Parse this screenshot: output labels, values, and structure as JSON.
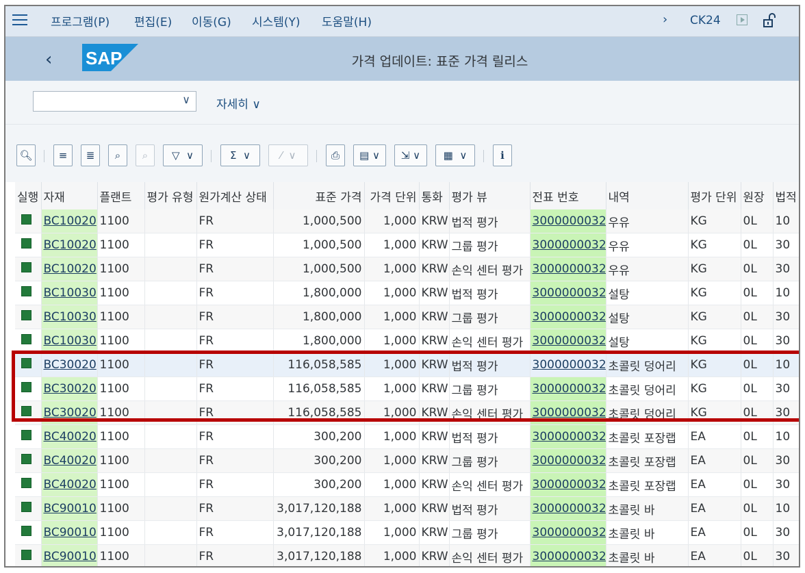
{
  "menu": {
    "items": [
      "프로그램(P)",
      "편집(E)",
      "이동(G)",
      "시스템(Y)",
      "도움말(H)"
    ],
    "tcode": "CK24"
  },
  "title": {
    "logo": "SAP",
    "text": "가격 업데이트: 표준 가격 릴리스"
  },
  "variant": {
    "value": "",
    "more_label": "자세히"
  },
  "table": {
    "columns": [
      "실행",
      "자재",
      "플랜트",
      "평가 유형",
      "원가계산 상태",
      "표준 가격",
      "가격 단위",
      "통화",
      "평가 뷰",
      "전표 번호",
      "내역",
      "평가 단위",
      "원장",
      "법적"
    ],
    "rows": [
      [
        "",
        "BC10020",
        "1100",
        "",
        "FR",
        "1,000,500",
        "1,000",
        "KRW",
        "법적 평가",
        "3000000032",
        "우유",
        "KG",
        "0L",
        "10"
      ],
      [
        "",
        "BC10020",
        "1100",
        "",
        "FR",
        "1,000,500",
        "1,000",
        "KRW",
        "그룹 평가",
        "3000000032",
        "우유",
        "KG",
        "0L",
        "30"
      ],
      [
        "",
        "BC10020",
        "1100",
        "",
        "FR",
        "1,000,500",
        "1,000",
        "KRW",
        "손익 센터 평가",
        "3000000032",
        "우유",
        "KG",
        "0L",
        "30"
      ],
      [
        "",
        "BC10030",
        "1100",
        "",
        "FR",
        "1,800,000",
        "1,000",
        "KRW",
        "법적 평가",
        "3000000032",
        "설탕",
        "KG",
        "0L",
        "10"
      ],
      [
        "",
        "BC10030",
        "1100",
        "",
        "FR",
        "1,800,000",
        "1,000",
        "KRW",
        "그룹 평가",
        "3000000032",
        "설탕",
        "KG",
        "0L",
        "30"
      ],
      [
        "",
        "BC10030",
        "1100",
        "",
        "FR",
        "1,800,000",
        "1,000",
        "KRW",
        "손익 센터 평가",
        "3000000032",
        "설탕",
        "KG",
        "0L",
        "30"
      ],
      [
        "",
        "BC30020",
        "1100",
        "",
        "FR",
        "116,058,585",
        "1,000",
        "KRW",
        "법적 평가",
        "3000000032",
        "초콜릿 덩어리",
        "KG",
        "0L",
        "10"
      ],
      [
        "",
        "BC30020",
        "1100",
        "",
        "FR",
        "116,058,585",
        "1,000",
        "KRW",
        "그룹 평가",
        "3000000032",
        "초콜릿 덩어리",
        "KG",
        "0L",
        "30"
      ],
      [
        "",
        "BC30020",
        "1100",
        "",
        "FR",
        "116,058,585",
        "1,000",
        "KRW",
        "손익 센터 평가",
        "3000000032",
        "초콜릿 덩어리",
        "KG",
        "0L",
        "30"
      ],
      [
        "",
        "BC40020",
        "1100",
        "",
        "FR",
        "300,200",
        "1,000",
        "KRW",
        "법적 평가",
        "3000000032",
        "초콜릿 포장랩",
        "EA",
        "0L",
        "10"
      ],
      [
        "",
        "BC40020",
        "1100",
        "",
        "FR",
        "300,200",
        "1,000",
        "KRW",
        "그룹 평가",
        "3000000032",
        "초콜릿 포장랩",
        "EA",
        "0L",
        "30"
      ],
      [
        "",
        "BC40020",
        "1100",
        "",
        "FR",
        "300,200",
        "1,000",
        "KRW",
        "손익 센터 평가",
        "3000000032",
        "초콜릿 포장랩",
        "EA",
        "0L",
        "30"
      ],
      [
        "",
        "BC90010",
        "1100",
        "",
        "FR",
        "3,017,120,188",
        "1,000",
        "KRW",
        "법적 평가",
        "3000000032",
        "초콜릿 바",
        "EA",
        "0L",
        "10"
      ],
      [
        "",
        "BC90010",
        "1100",
        "",
        "FR",
        "3,017,120,188",
        "1,000",
        "KRW",
        "그룹 평가",
        "3000000032",
        "초콜릿 바",
        "EA",
        "0L",
        "30"
      ],
      [
        "",
        "BC90010",
        "1100",
        "",
        "FR",
        "3,017,120,188",
        "1,000",
        "KRW",
        "손익 센터 평가",
        "3000000032",
        "초콜릿 바",
        "EA",
        "0L",
        "30"
      ]
    ]
  },
  "colors": {
    "status_green": "#237a3b",
    "highlight_red": "#b70000",
    "link_bg": "#d6f5c6",
    "titlebar_bg": "#b6cbe0"
  }
}
